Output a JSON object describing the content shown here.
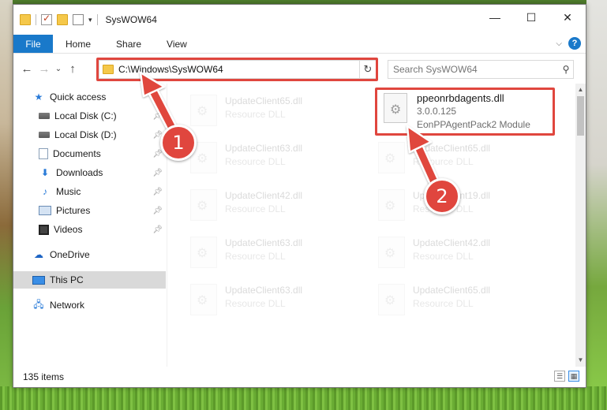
{
  "window": {
    "title": "SysWOW64"
  },
  "window_controls": {
    "minimize": "—",
    "maximize": "☐",
    "close": "✕"
  },
  "ribbon": {
    "tabs": [
      "File",
      "Home",
      "Share",
      "View"
    ]
  },
  "address": {
    "path": "C:\\Windows\\SysWOW64"
  },
  "search": {
    "placeholder": "Search SysWOW64"
  },
  "sidebar": {
    "items": [
      {
        "label": "Quick access",
        "icon": "star-icon",
        "pinned": false
      },
      {
        "label": "Local Disk (C:)",
        "icon": "drive-icon",
        "pinned": true
      },
      {
        "label": "Local Disk (D:)",
        "icon": "drive-icon",
        "pinned": true
      },
      {
        "label": "Documents",
        "icon": "documents-icon",
        "pinned": true
      },
      {
        "label": "Downloads",
        "icon": "downloads-icon",
        "pinned": true
      },
      {
        "label": "Music",
        "icon": "music-icon",
        "pinned": true
      },
      {
        "label": "Pictures",
        "icon": "pictures-icon",
        "pinned": true
      },
      {
        "label": "Videos",
        "icon": "videos-icon",
        "pinned": true
      },
      {
        "label": "OneDrive",
        "icon": "onedrive-icon",
        "pinned": false
      },
      {
        "label": "This PC",
        "icon": "this-pc-icon",
        "pinned": false
      },
      {
        "label": "Network",
        "icon": "network-icon",
        "pinned": false
      }
    ]
  },
  "files": {
    "selected": {
      "name": "ppeonrbdagents.dll",
      "version": "3.0.0.125",
      "description": "EonPPAgentPack2 Module"
    },
    "left_column": [
      {
        "name": "UpdateClient65.dll",
        "type": "Resource DLL"
      },
      {
        "name": "UpdateClient63.dll",
        "type": "Resource DLL"
      },
      {
        "name": "UpdateClient42.dll",
        "type": "Resource DLL"
      },
      {
        "name": "UpdateClient63.dll",
        "type": "Resource DLL"
      },
      {
        "name": "UpdateClient63.dll",
        "type": "Resource DLL"
      }
    ],
    "right_column": [
      {
        "name": "UpdateClient65.dll",
        "type": "Resource DLL"
      },
      {
        "name": "UpdateClient19.dll",
        "type": "Resource DLL"
      },
      {
        "name": "UpdateClient42.dll",
        "type": "Resource DLL"
      },
      {
        "name": "UpdateClient65.dll",
        "type": "Resource DLL"
      }
    ]
  },
  "status": {
    "count": "135 items"
  },
  "annotations": {
    "step1": "1",
    "step2": "2",
    "color": "#e0463e"
  }
}
